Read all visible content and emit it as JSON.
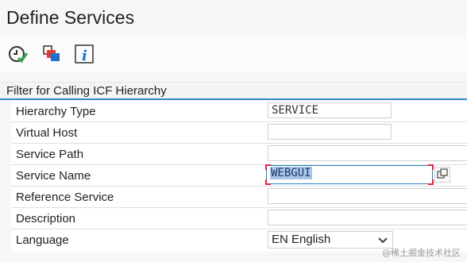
{
  "window": {
    "title": "Define Services"
  },
  "toolbar": {
    "buttons": [
      {
        "icon": "execute-clock-icon"
      },
      {
        "icon": "hierarchy-icon"
      },
      {
        "icon": "info-icon"
      }
    ]
  },
  "section": {
    "title": "Filter for Calling ICF Hierarchy"
  },
  "form": {
    "hierarchy_type": {
      "label": "Hierarchy Type",
      "value": "SERVICE"
    },
    "virtual_host": {
      "label": "Virtual Host",
      "value": ""
    },
    "service_path": {
      "label": "Service Path",
      "value": ""
    },
    "service_name": {
      "label": "Service Name",
      "value": "WEBGUI"
    },
    "reference_service": {
      "label": "Reference Service",
      "value": ""
    },
    "description": {
      "label": "Description",
      "value": ""
    },
    "language": {
      "label": "Language",
      "value": "EN English"
    }
  },
  "watermark": "@稀土掘金技术社区",
  "colors": {
    "accent": "#2a8fc9",
    "selection": "#a8c5e8",
    "focus_corner": "#e4243b"
  }
}
